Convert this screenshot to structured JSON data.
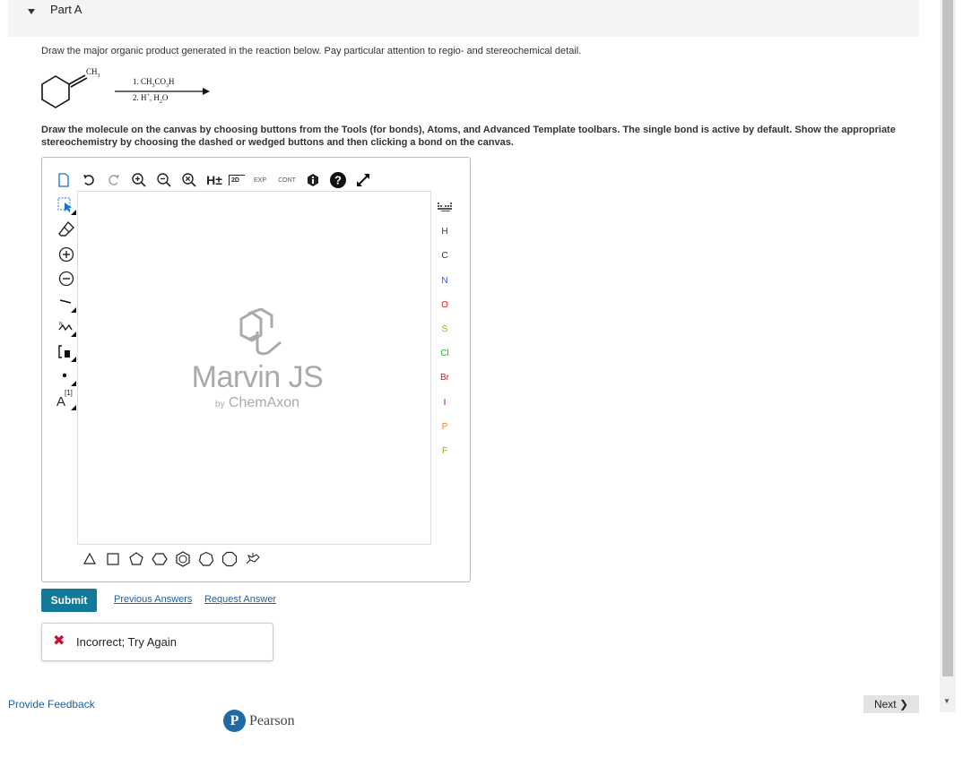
{
  "part": {
    "title": "Part A"
  },
  "question": {
    "prompt": "Draw the major organic product generated in the reaction below. Pay particular attention to regio- and stereochemical detail.",
    "reactant_label": "CH",
    "reactant_sub": "3",
    "step1": "1. CH",
    "step1_sub1": "3",
    "step1_mid": "CO",
    "step1_sub2": "3",
    "step1_end": "H",
    "step2": "2. H",
    "step2_sup": "+",
    "step2_mid": ", H",
    "step2_sub": "2",
    "step2_end": "O",
    "instructions": "Draw the molecule on the canvas by choosing buttons from the Tools (for bonds), Atoms, and Advanced Template toolbars. The single bond is active by default. Show the appropriate stereochemistry by choosing the dashed or wedged buttons and then clicking a bond on the canvas."
  },
  "editor": {
    "logo_title": "Marvin JS",
    "logo_by": "by",
    "logo_company": "ChemAxon",
    "toolbar": {
      "hplus": "H±",
      "twod": "2D",
      "exp": "EXP",
      "cont": "CONT"
    },
    "left_tools": {
      "atom_map": "A",
      "atom_map_idx": "[1]"
    },
    "atoms": [
      "H",
      "C",
      "N",
      "O",
      "S",
      "Cl",
      "Br",
      "I",
      "P",
      "F"
    ],
    "atom_colors": {
      "H": "#333333",
      "C": "#333333",
      "N": "#3050F8",
      "O": "#FF0D0D",
      "S": "#B8A000",
      "Cl": "#1FAF1F",
      "Br": "#A62929",
      "I": "#940094",
      "P": "#FF8000",
      "F": "#90B000"
    }
  },
  "actions": {
    "submit": "Submit",
    "previous_answers": "Previous Answers",
    "request_answer": "Request Answer"
  },
  "feedback": {
    "icon": "✖",
    "message": "Incorrect; Try Again"
  },
  "footer": {
    "provide_feedback": "Provide Feedback",
    "next": "Next ❯",
    "brand": "Pearson",
    "brand_mark": "P"
  },
  "colors": {
    "accent": "#127a98",
    "link": "#1f5f9a",
    "error": "#c8102e"
  }
}
